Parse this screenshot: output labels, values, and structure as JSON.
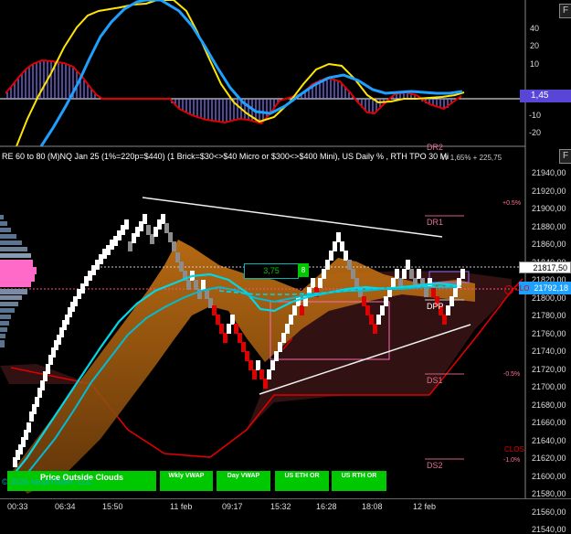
{
  "panel_buttons": {
    "upper_F": "F",
    "lower_F": "F"
  },
  "indicator_panel": {
    "y_ticks": [
      "40",
      "20",
      "10",
      "-10",
      "-20"
    ],
    "value_badge": "1,45"
  },
  "price_panel": {
    "title": "RE 60 to 80 (M)NQ Jan 25 (1%=220p=$440) (1 Brick=$30<>$40 Micro or $300<>$400 Mini), US Daily % , RTH TPO 30 Mi",
    "y_ticks": [
      "21940,00",
      "21920,00",
      "21900,00",
      "21880,00",
      "21860,00",
      "21840,00",
      "21820,00",
      "21800,00",
      "21780,00",
      "21760,00",
      "21740,00",
      "21720,00",
      "21700,00",
      "21680,00",
      "21660,00",
      "21640,00",
      "21620,00",
      "21600,00",
      "21580,00",
      "21560,00",
      "21540,00"
    ],
    "price_badge_top": "21817,50",
    "price_badge_bottom": "21792,18",
    "levels": {
      "dr2": "DR2",
      "dr1": "DR1",
      "dpp": "DPP",
      "ds1": "DS1",
      "ds2": "DS2",
      "clo_short": "CLO",
      "clos": "CLOS"
    },
    "percent_labels": {
      "plus05": "+0.5%",
      "minus05": "-0.5%",
      "minus10": "-1.0%"
    },
    "top_right_readout": "W 1,65% +  225,75",
    "box_value": "3,75",
    "box_count": "8",
    "copyright": "© 2025 NinjaTrader, LLC",
    "watermark": "Price Outside Clouds"
  },
  "buttons": {
    "price_outside_clouds": "Price Outside Clouds",
    "wkly_vwap": "Wkly VWAP",
    "day_vwap": "Day VWAP",
    "us_eth_or": "US ETH OR",
    "us_rth_or": "US RTH OR"
  },
  "x_axis": {
    "ticks": [
      "00:33",
      "06:34",
      "15:50",
      "11 feb",
      "09:17",
      "15:32",
      "16:28",
      "18:08",
      "12 feb"
    ]
  },
  "colors": {
    "accent_green": "#00c800",
    "cyan": "#00bfff",
    "yellow": "#ffe600",
    "blue": "#1ea0ff",
    "red": "#e00000",
    "purple": "#7a5cff",
    "orange": "#c8781e",
    "pink": "#ff69b4"
  }
}
